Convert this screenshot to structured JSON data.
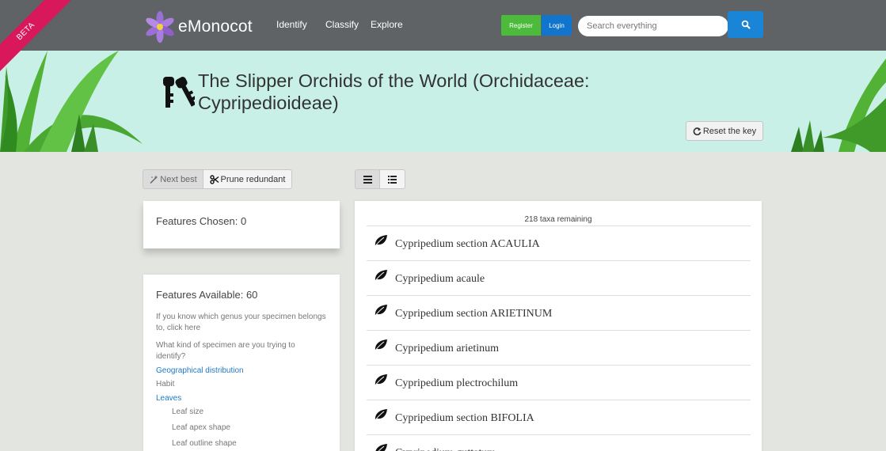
{
  "beta": "BETA",
  "brand": {
    "name": "eMonocot"
  },
  "nav": {
    "identify": "Identify",
    "classify": "Classify",
    "explore": "Explore"
  },
  "auth": {
    "register": "Register",
    "login": "Login"
  },
  "search": {
    "placeholder": "Search everything",
    "icon": "search-icon"
  },
  "key": {
    "title": "The Slipper Orchids of the World (Orchidaceae: Cypripedioideae)",
    "reset_label": "Reset the key"
  },
  "toolbar": {
    "next_best": "Next best",
    "prune": "Prune redundant"
  },
  "view": {
    "grid_icon": "grid-icon",
    "list_icon": "list-icon"
  },
  "features_chosen": {
    "heading": "Features Chosen: 0"
  },
  "features_available": {
    "heading": "Features Available: 60",
    "lines": [
      "If you know which genus your specimen belongs to, click here",
      "What kind of specimen are you trying to identify?"
    ],
    "links": [
      "Geographical distribution"
    ],
    "habit": "Habit",
    "leaves": "Leaves",
    "leaf_subs": [
      "Leaf size",
      "Leaf apex shape",
      "Leaf outline shape"
    ]
  },
  "results": {
    "remaining": "218 taxa remaining",
    "taxa": [
      "Cypripedium section ACAULIA",
      "Cypripedium acaule",
      "Cypripedium section ARIETINUM",
      "Cypripedium arietinum",
      "Cypripedium plectrochilum",
      "Cypripedium section BIFOLIA",
      "Cypripedium guttatum"
    ]
  },
  "colors": {
    "topbar": "#5f6366",
    "band": "#c8f0e6",
    "register": "#4cba3a",
    "login": "#1175ce",
    "link": "#1e7ac6",
    "beta_ribbon": "#d8185a"
  }
}
